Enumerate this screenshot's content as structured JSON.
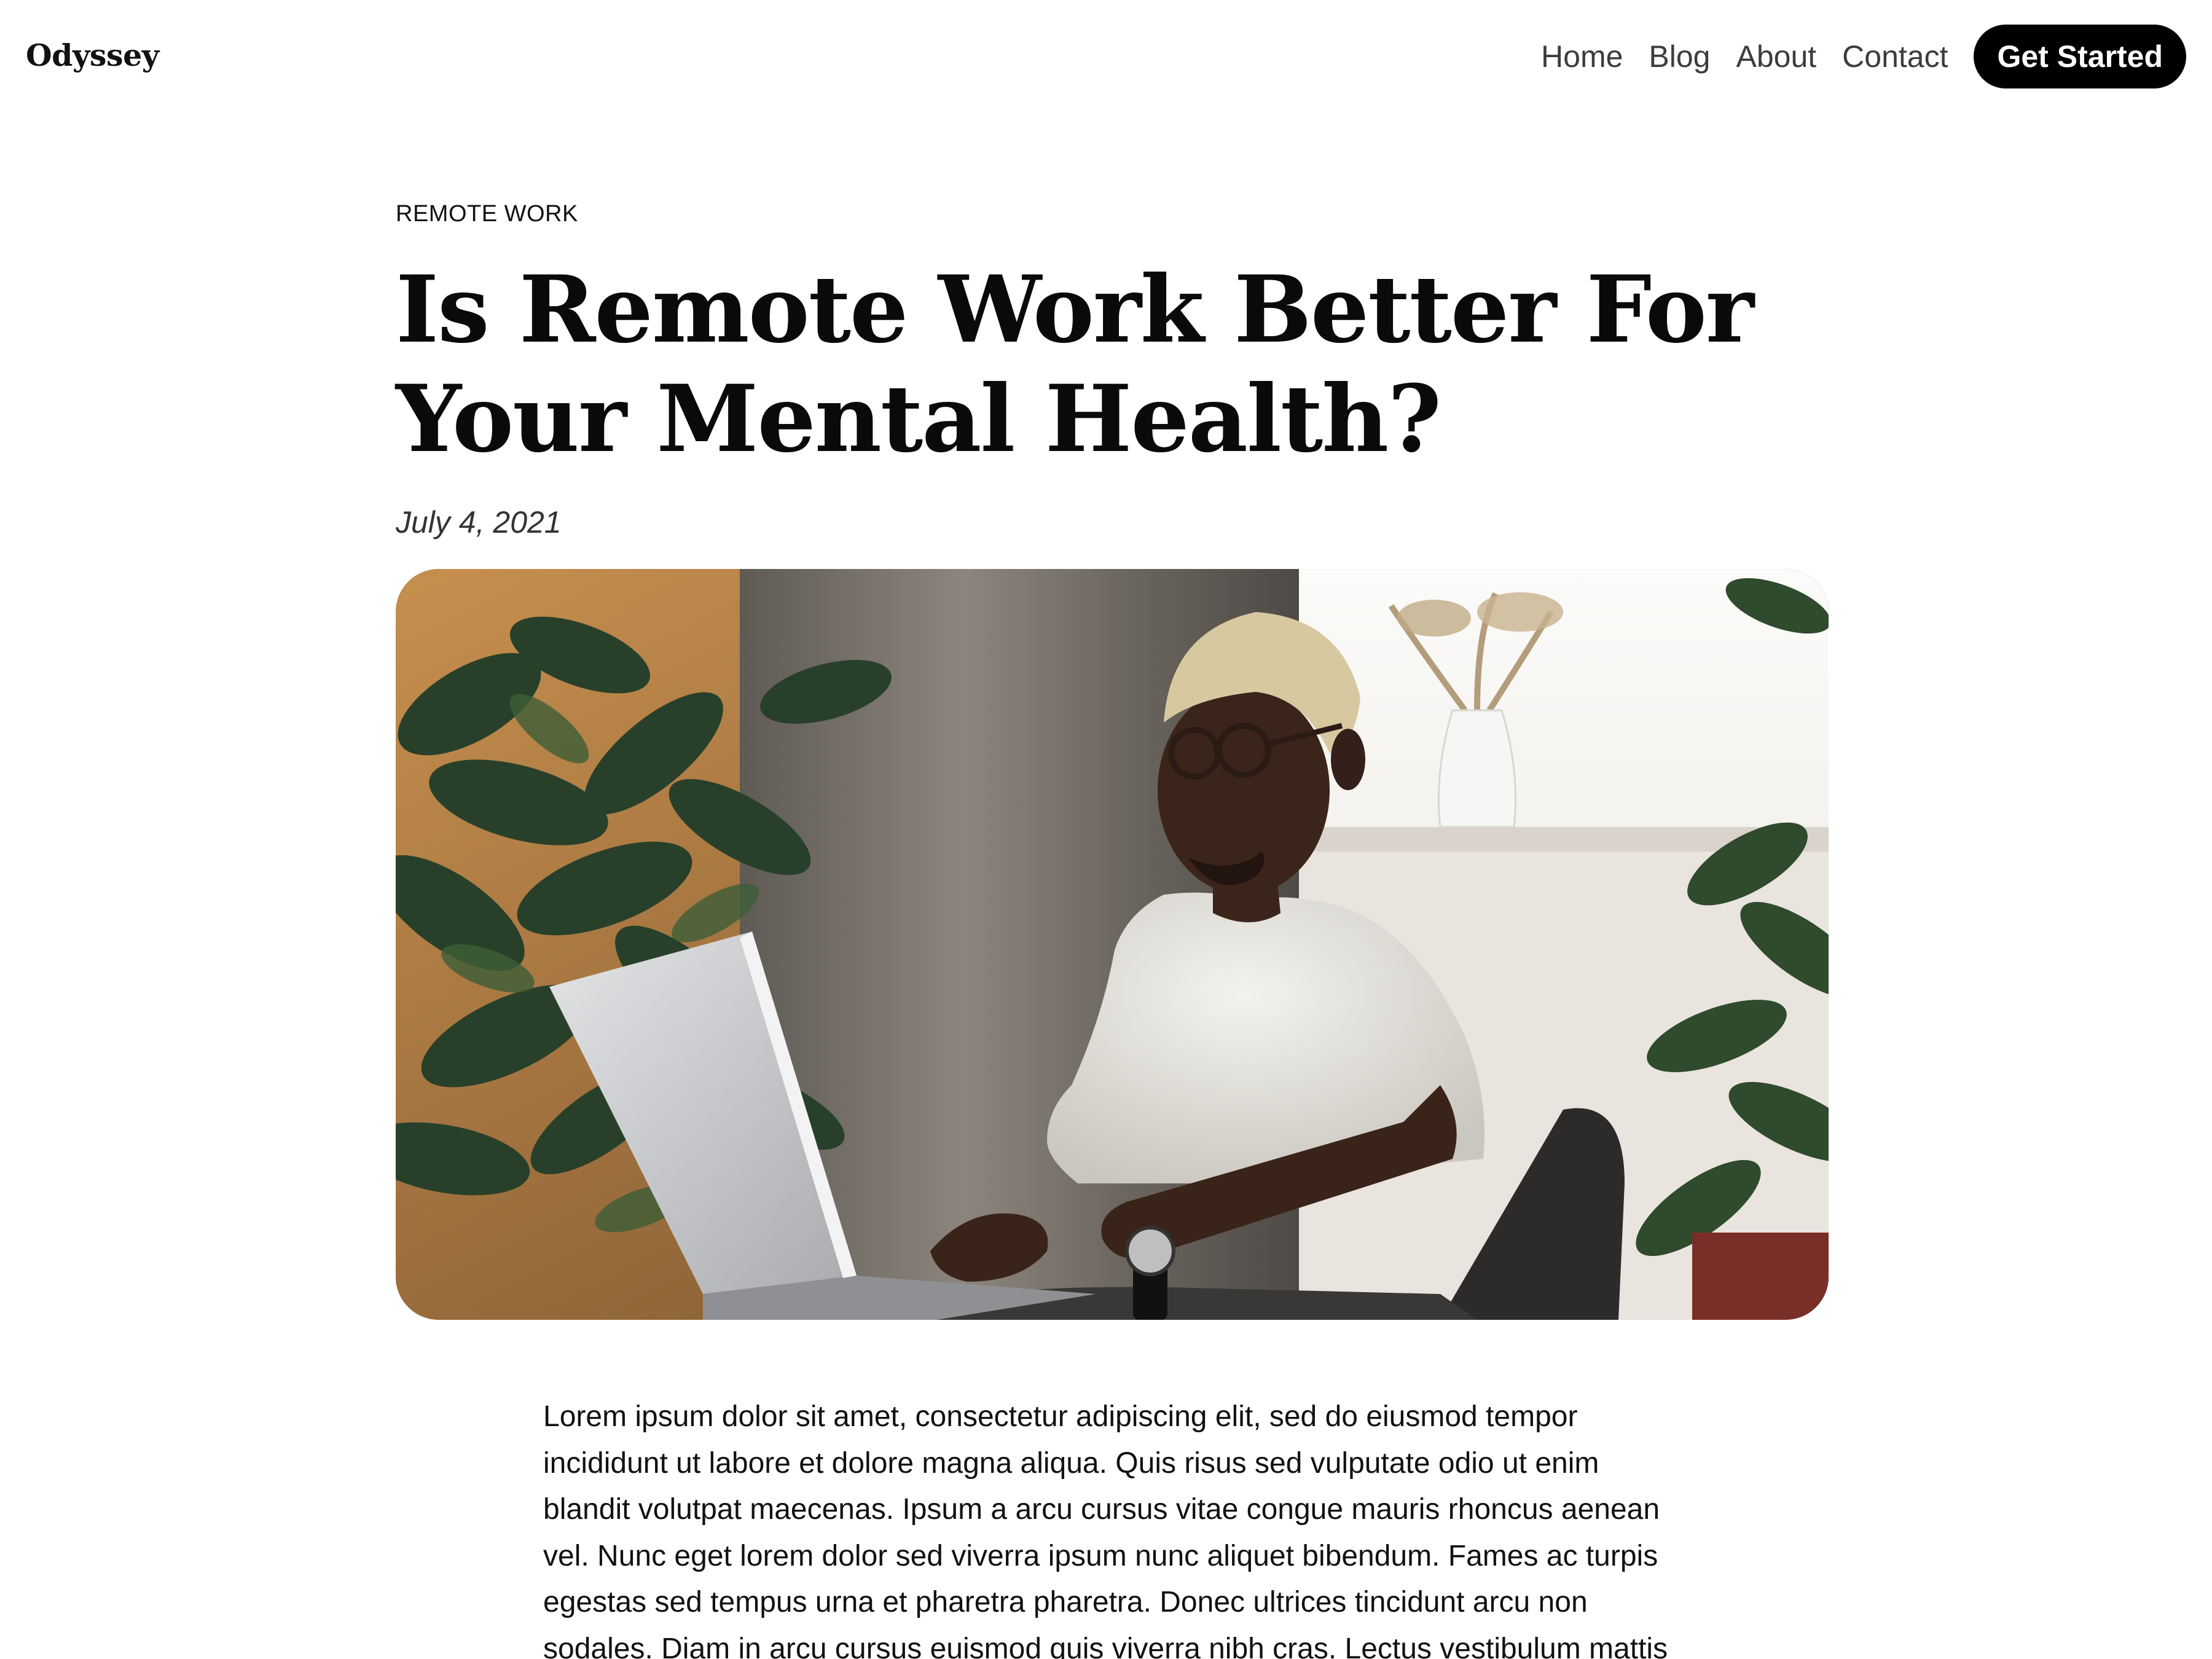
{
  "site": {
    "logo": "Odyssey"
  },
  "nav": {
    "items": [
      {
        "label": "Home"
      },
      {
        "label": "Blog"
      },
      {
        "label": "About"
      },
      {
        "label": "Contact"
      }
    ],
    "cta_label": "Get Started"
  },
  "article": {
    "category": "REMOTE WORK",
    "title": "Is Remote Work Better For Your Mental Health?",
    "date": "July 4, 2021",
    "body": "Lorem ipsum dolor sit amet, consectetur adipiscing elit, sed do eiusmod tempor incididunt ut labore et dolore magna aliqua. Quis risus sed vulputate odio ut enim blandit volutpat maecenas. Ipsum a arcu cursus vitae congue mauris rhoncus aenean vel. Nunc eget lorem dolor sed viverra ipsum nunc aliquet bibendum. Fames ac turpis egestas sed tempus urna et pharetra pharetra. Donec ultrices tincidunt arcu non sodales. Diam in arcu cursus euismod quis viverra nibh cras. Lectus vestibulum mattis"
  },
  "colors": {
    "cta_background": "#000000",
    "cta_text": "#ffffff",
    "nav_text": "#3c3c3c",
    "text": "#111111"
  },
  "icons": {
    "hero": "photo-man-with-laptop"
  }
}
